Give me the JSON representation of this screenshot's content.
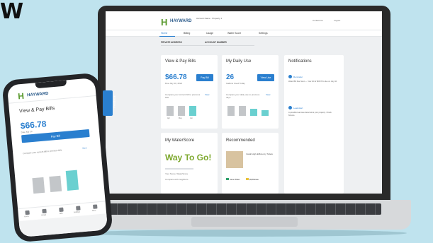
{
  "corner_letter": "W",
  "laptop": {
    "brand": "HAYWARD",
    "account_info": "Account Name · Property 1",
    "top_links": [
      "Contact Us",
      "Logout"
    ],
    "nav": [
      "Home",
      "Billing",
      "Usage",
      "Water Score",
      "Settings"
    ],
    "sub_labels": [
      "PRIVATE ADDRESS",
      "ACCOUNT NUMBER"
    ],
    "feedback_label": "Feedback",
    "cards": {
      "view_pay": {
        "title": "View & Pay Bills",
        "amount": "$66.78",
        "due": "Due July 10, 2021",
        "button": "Pay Bill",
        "compare_text": "Compare your current bill to previous bills",
        "compare_link": "View",
        "bar_labels": [
          "Apr",
          "May",
          "Jun"
        ]
      },
      "daily_use": {
        "title": "My Daily Use",
        "amount": "26",
        "unit": "Gallons Used Today",
        "button": "View Use",
        "compare_text": "Compare your daily use to previous days",
        "compare_link": "View"
      },
      "notifications": {
        "title": "Notifications",
        "items": [
          {
            "title": "Reminder",
            "text": "Water Bill Due Soon — Your bill of $66.78 is due on July 10."
          },
          {
            "title": "Leak Alert",
            "text": "A possible leak was detected at your property. Check fixtures."
          }
        ]
      },
      "water_score": {
        "title": "My WaterScore",
        "score": "Way To Go!",
        "line1": "Your Score: WaterScore",
        "line2": "Compare with neighbors"
      },
      "recommended": {
        "title": "Recommended",
        "item_title": "Install High-Efficiency Toilets",
        "badge1": "Save Water",
        "badge2": "$$ Rebate"
      }
    }
  },
  "phone": {
    "brand": "HAYWARD",
    "title": "View & Pay Bills",
    "amount": "$66.78",
    "due": "Due July 10",
    "button": "Pay Bill",
    "compare_text": "Compare your current bill to previous bills",
    "compare_link": "View",
    "nav": [
      "Home",
      "Usage",
      "Bills",
      "Settings",
      "More"
    ]
  }
}
